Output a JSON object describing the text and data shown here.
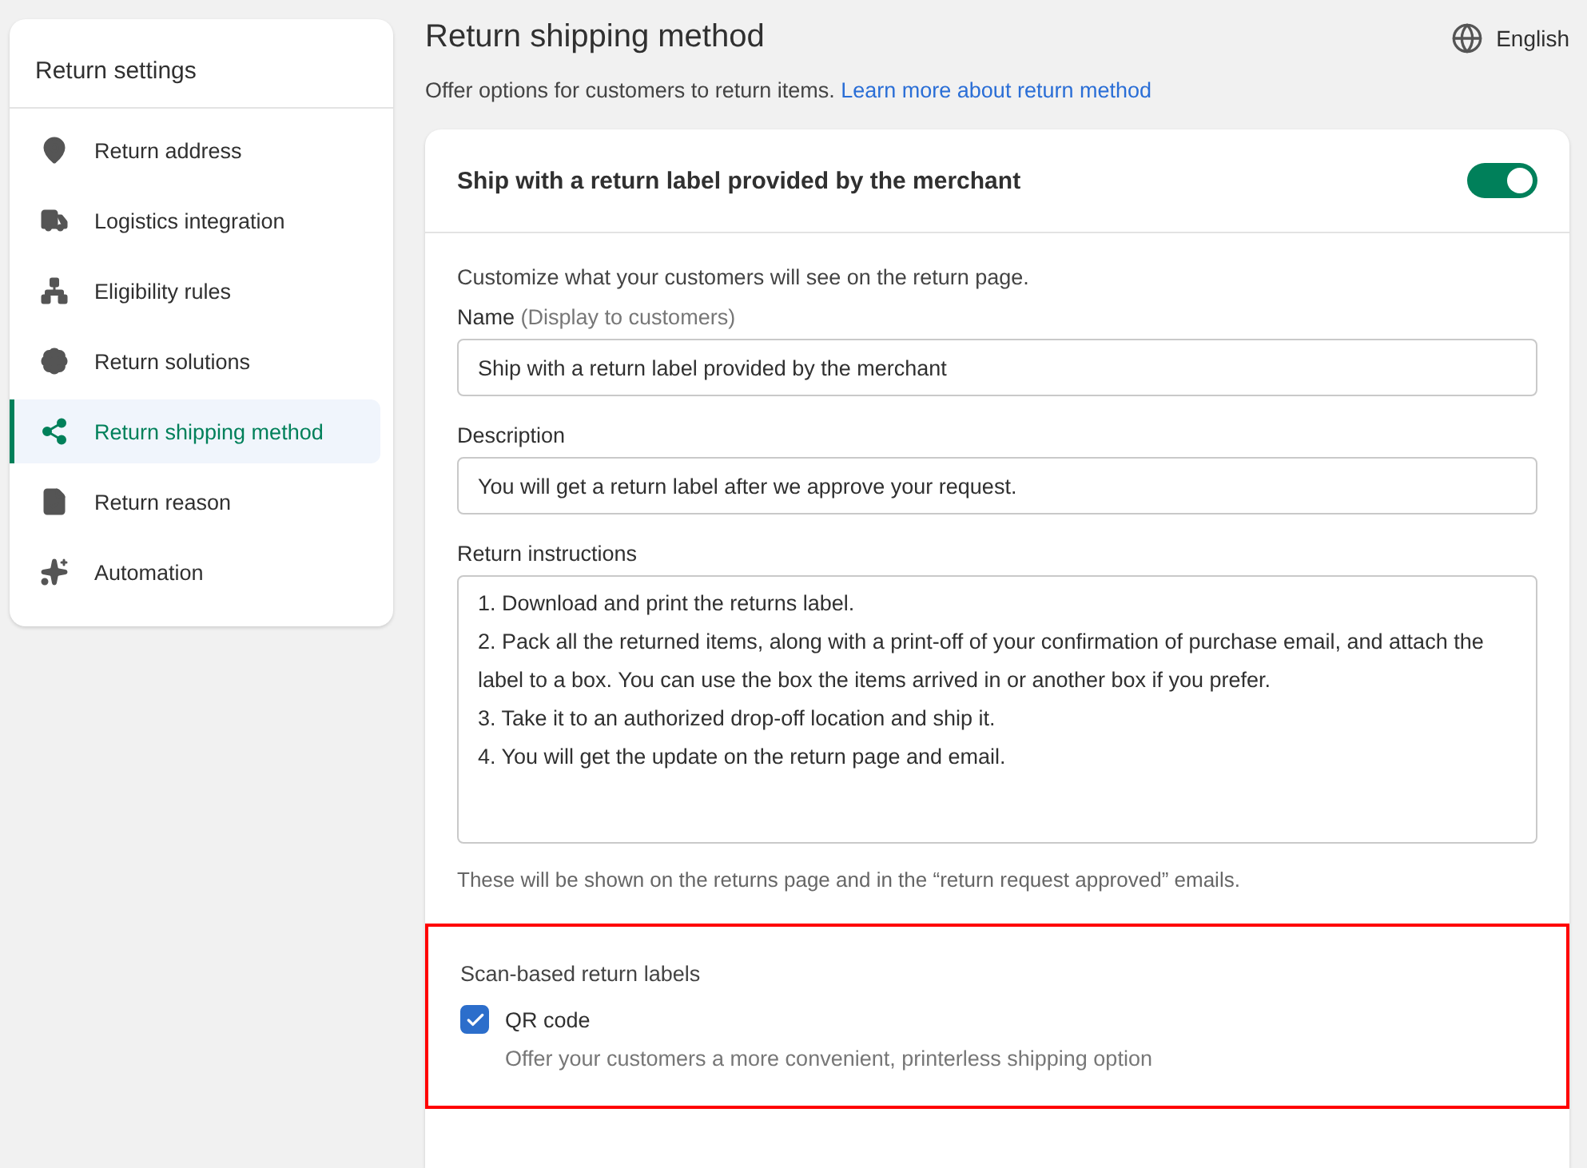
{
  "sidebar": {
    "title": "Return settings",
    "items": [
      {
        "label": "Return address",
        "selected": false
      },
      {
        "label": "Logistics integration",
        "selected": false
      },
      {
        "label": "Eligibility rules",
        "selected": false
      },
      {
        "label": "Return solutions",
        "selected": false
      },
      {
        "label": "Return shipping method",
        "selected": true
      },
      {
        "label": "Return reason",
        "selected": false
      },
      {
        "label": "Automation",
        "selected": false
      }
    ]
  },
  "header": {
    "title": "Return shipping method",
    "language": "English",
    "description": "Offer options for customers to return items.",
    "link": "Learn more about return method"
  },
  "method_card": {
    "title": "Ship with a return label provided by the merchant",
    "enabled": true,
    "intro": "Customize what your customers will see on the return page.",
    "name_field": {
      "label": "Name",
      "hint": "(Display to customers)",
      "value": "Ship with a return label provided by the merchant"
    },
    "description_field": {
      "label": "Description",
      "value": "You will get a return label after we approve your request."
    },
    "instructions_field": {
      "label": "Return instructions",
      "value": "1. Download and print the returns label.\n2. Pack all the returned items, along with a print-off of your confirmation of purchase email, and attach the label to a box. You can use the box the items arrived in or another box if you prefer.\n3. Take it to an authorized drop-off location and ship it.\n4. You will get the update on the return page and email."
    },
    "footnote": "These will be shown on the returns page and in the “return request approved” emails.",
    "scan_labels": {
      "title": "Scan-based return labels",
      "highlighted": true,
      "options": [
        {
          "label": "QR code",
          "checked": true,
          "help": "Offer your customers a more convenient, printerless shipping option"
        }
      ]
    }
  }
}
